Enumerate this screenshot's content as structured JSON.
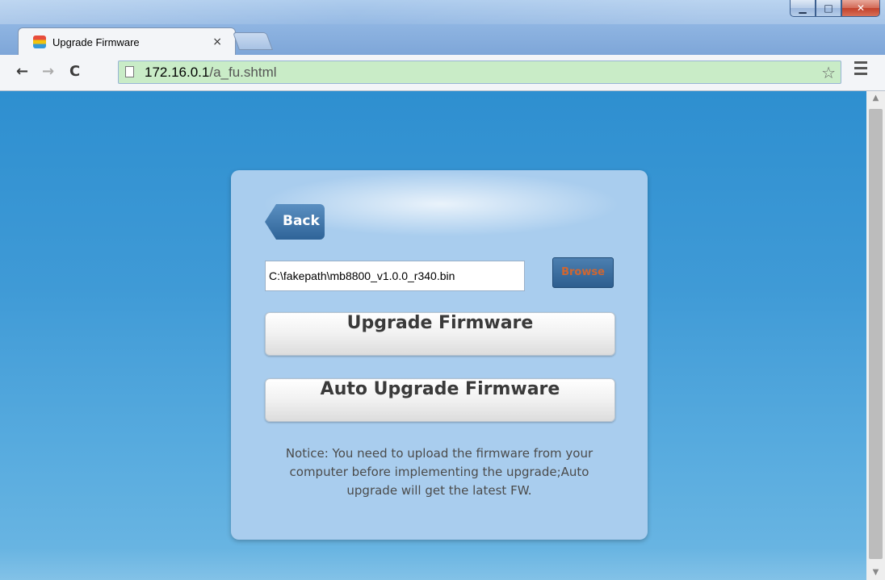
{
  "window": {
    "minimize_icon": "minimize-icon",
    "maximize_icon": "maximize-icon",
    "close_icon": "close-icon"
  },
  "tab": {
    "title": "Upgrade Firmware",
    "close": "×"
  },
  "toolbar": {
    "back": "←",
    "forward": "→",
    "reload": "C",
    "url_host": "172.16.0.1",
    "url_path": "/a_fu.shtml",
    "star": "☆"
  },
  "card": {
    "back_label": "Back",
    "file_value": "C:\\fakepath\\mb8800_v1.0.0_r340.bin",
    "browse_label": "Browse",
    "upgrade_label": "Upgrade Firmware",
    "auto_upgrade_label": "Auto Upgrade Firmware",
    "notice": "Notice: You need to upload the firmware from your computer before implementing the upgrade;Auto upgrade will get the latest FW."
  },
  "colors": {
    "page_bg": "#3f9ad6",
    "card_bg": "#a9cdee",
    "browse_text": "#d2662f",
    "omnibox_bg": "#c9ecc7"
  }
}
